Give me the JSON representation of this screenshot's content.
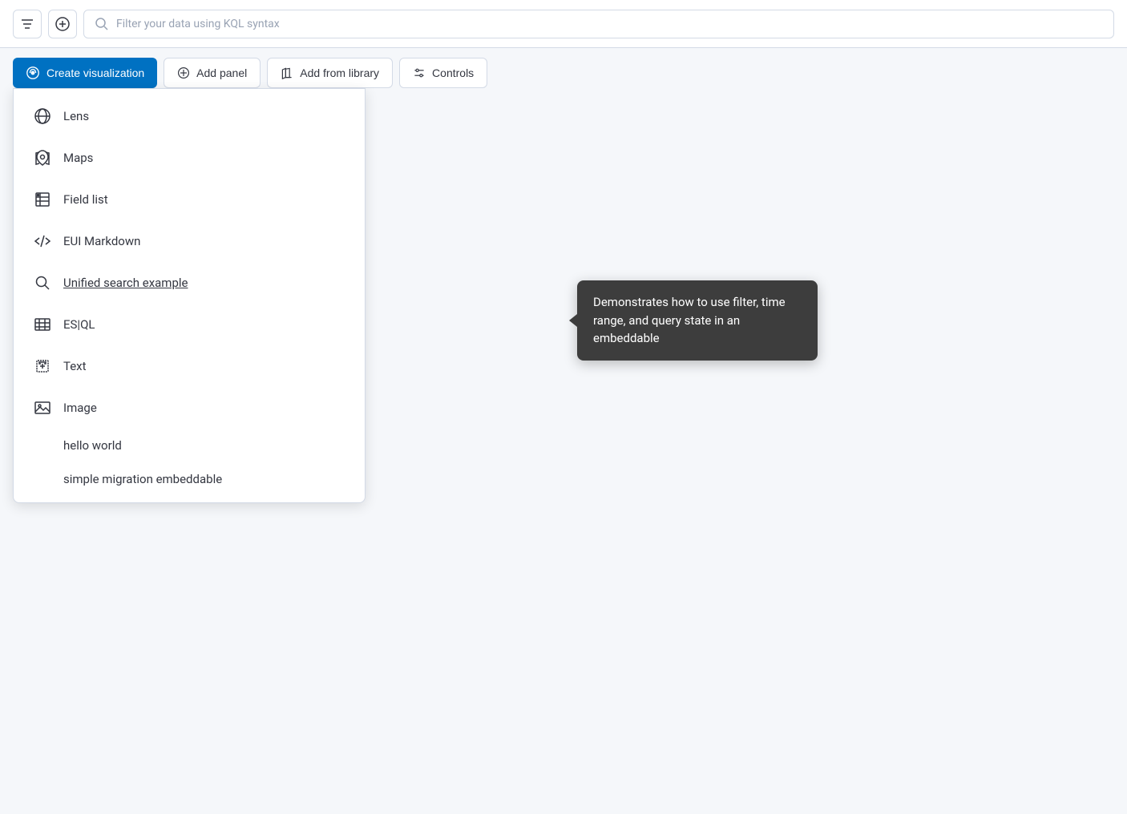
{
  "toolbar": {
    "filter_icon_label": "filter-icon",
    "add_icon_label": "add-icon",
    "search_placeholder": "Filter your data using KQL syntax"
  },
  "action_bar": {
    "create_visualization_label": "Create visualization",
    "add_panel_label": "Add panel",
    "add_from_library_label": "Add from library",
    "controls_label": "Controls"
  },
  "dropdown": {
    "items": [
      {
        "id": "lens",
        "label": "Lens",
        "icon": "lens"
      },
      {
        "id": "maps",
        "label": "Maps",
        "icon": "maps"
      },
      {
        "id": "field-list",
        "label": "Field list",
        "icon": "field-list"
      },
      {
        "id": "eui-markdown",
        "label": "EUI Markdown",
        "icon": "code"
      },
      {
        "id": "unified-search",
        "label": "Unified search example",
        "icon": "search",
        "underline": true
      },
      {
        "id": "esql",
        "label": "ES|QL",
        "icon": "esql"
      },
      {
        "id": "text",
        "label": "Text",
        "icon": "text"
      },
      {
        "id": "image",
        "label": "Image",
        "icon": "image"
      }
    ],
    "subitems": [
      {
        "id": "hello-world",
        "label": "hello world"
      },
      {
        "id": "simple-migration",
        "label": "simple migration embeddable"
      }
    ]
  },
  "tooltip": {
    "text": "Demonstrates how to use filter, time range, and query state in an embeddable"
  }
}
